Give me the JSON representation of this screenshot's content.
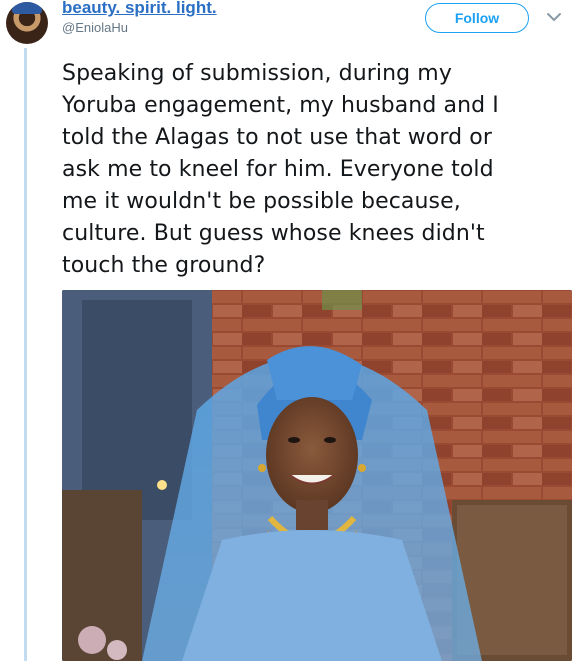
{
  "tweet": {
    "display_name": "beauty. spirit. light.",
    "handle": "@EniolaHu",
    "follow_label": "Follow",
    "text": "Speaking of submission, during my\nYoruba engagement, my husband and I\ntold the Alagas to not use that word or\nask me to kneel for him. Everyone told\nme it wouldn't be possible because,\nculture. But guess whose knees didn't\ntouch the ground?"
  },
  "icons": {
    "menu": "chevron-down-icon",
    "avatar": "profile-avatar"
  },
  "colors": {
    "accent": "#1da1f2",
    "name_link": "#2a6fc4",
    "thread_line": "#c4dcf1",
    "text": "#14171a",
    "muted": "#657786"
  }
}
